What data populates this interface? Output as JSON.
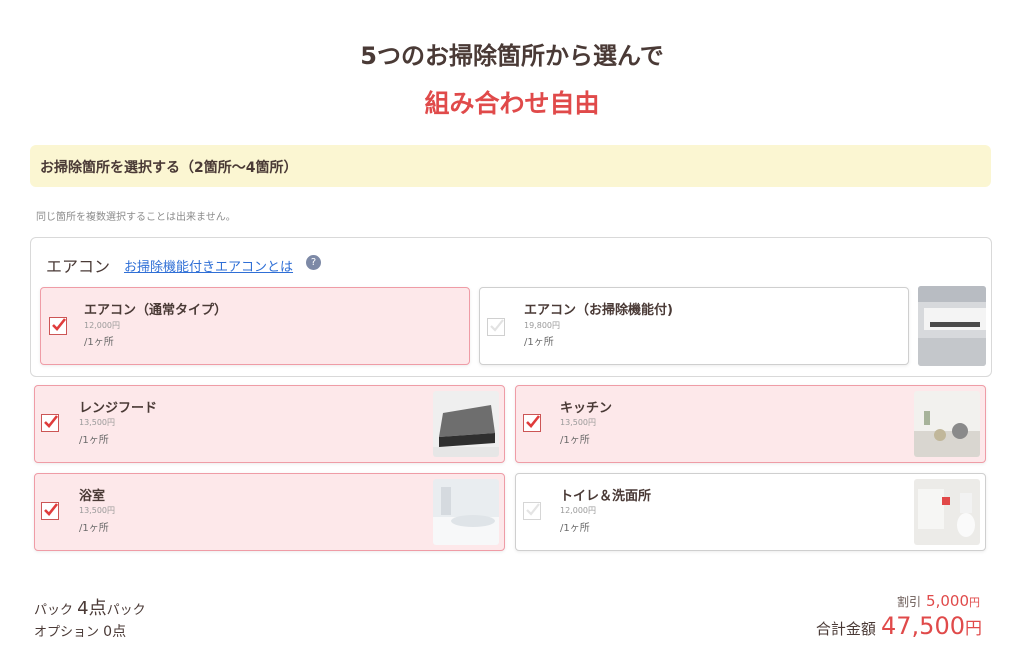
{
  "heading": {
    "line1": "5つのお掃除箇所から選んで",
    "line2": "組み合わせ自由"
  },
  "banner": {
    "text": "お掃除箇所を選択する（2箇所〜4箇所）"
  },
  "note": "同じ箇所を複数選択することは出来ません。",
  "aircon_group": {
    "label": "エアコン",
    "link": "お掃除機能付きエアコンとは",
    "help": "?"
  },
  "items": [
    {
      "name": "エアコン（通常タイプ）",
      "price": "12,000円",
      "unit": "/1ヶ所",
      "selected": true
    },
    {
      "name": "エアコン（お掃除機能付)",
      "price": "19,800円",
      "unit": "/1ヶ所",
      "selected": false
    },
    {
      "name": "レンジフード",
      "price": "13,500円",
      "unit": "/1ヶ所",
      "selected": true
    },
    {
      "name": "キッチン",
      "price": "13,500円",
      "unit": "/1ヶ所",
      "selected": true
    },
    {
      "name": "浴室",
      "price": "13,500円",
      "unit": "/1ヶ所",
      "selected": true
    },
    {
      "name": "トイレ＆洗面所",
      "price": "12,000円",
      "unit": "/1ヶ所",
      "selected": false
    }
  ],
  "summary": {
    "pack_label": "パック",
    "pack_value": "4点",
    "pack_suffix": "パック",
    "option_label": "オプション",
    "option_value": "0点",
    "discount_label": "割引",
    "discount_value": "5,000",
    "discount_unit": "円",
    "total_label": "合計金額",
    "total_value": "47,500",
    "total_unit": "円"
  },
  "colors": {
    "accent": "#e04a4a",
    "selected_bg": "#fde8ea",
    "banner_bg": "#fbf6d2",
    "link": "#2f6fd6"
  }
}
